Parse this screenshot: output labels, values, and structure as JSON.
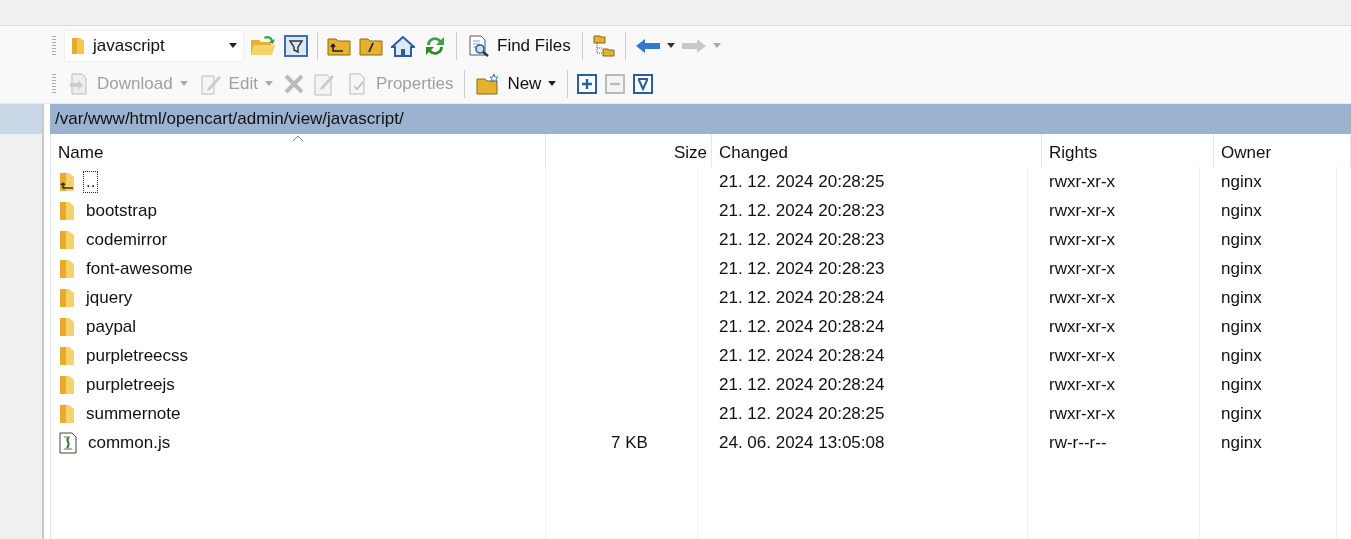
{
  "location": {
    "value": "javascript"
  },
  "find_files": {
    "label": "Find Files",
    "disabled": false
  },
  "actions": [
    {
      "kind": "download",
      "label": "Download",
      "disabled": true,
      "dropdown": true
    },
    {
      "kind": "edit",
      "label": "Edit",
      "disabled": true,
      "dropdown": true
    },
    {
      "kind": "properties",
      "label": "Properties",
      "disabled": true,
      "dropdown": false
    },
    {
      "kind": "new",
      "label": "New",
      "disabled": false,
      "dropdown": true
    }
  ],
  "path": "/var/www/html/opencart/admin/view/javascript/",
  "columns": [
    {
      "label": "Name",
      "sorted": true
    },
    {
      "label": "Size",
      "sorted": false
    },
    {
      "label": "Changed",
      "sorted": false
    },
    {
      "label": "Rights",
      "sorted": false
    },
    {
      "label": "Owner",
      "sorted": false
    }
  ],
  "rows": [
    {
      "kind": "parent",
      "name": "..",
      "changed": "21. 12. 2024 20:28:25",
      "rights": "rwxr-xr-x",
      "owner": "nginx",
      "focused": true
    },
    {
      "kind": "folder",
      "name": "bootstrap",
      "changed": "21. 12. 2024 20:28:23",
      "rights": "rwxr-xr-x",
      "owner": "nginx",
      "focused": false
    },
    {
      "kind": "folder",
      "name": "codemirror",
      "changed": "21. 12. 2024 20:28:23",
      "rights": "rwxr-xr-x",
      "owner": "nginx",
      "focused": false
    },
    {
      "kind": "folder",
      "name": "font-awesome",
      "changed": "21. 12. 2024 20:28:23",
      "rights": "rwxr-xr-x",
      "owner": "nginx",
      "focused": false
    },
    {
      "kind": "folder",
      "name": "jquery",
      "changed": "21. 12. 2024 20:28:24",
      "rights": "rwxr-xr-x",
      "owner": "nginx",
      "focused": false
    },
    {
      "kind": "folder",
      "name": "paypal",
      "changed": "21. 12. 2024 20:28:24",
      "rights": "rwxr-xr-x",
      "owner": "nginx",
      "focused": false
    },
    {
      "kind": "folder",
      "name": "purpletreecss",
      "changed": "21. 12. 2024 20:28:24",
      "rights": "rwxr-xr-x",
      "owner": "nginx",
      "focused": false
    },
    {
      "kind": "folder",
      "name": "purpletreejs",
      "changed": "21. 12. 2024 20:28:24",
      "rights": "rwxr-xr-x",
      "owner": "nginx",
      "focused": false
    },
    {
      "kind": "folder",
      "name": "summernote",
      "changed": "21. 12. 2024 20:28:25",
      "rights": "rwxr-xr-x",
      "owner": "nginx",
      "focused": false
    },
    {
      "kind": "file",
      "name": "common.js",
      "size": "7 KB",
      "changed": "24. 06. 2024 13:05:08",
      "rights": "rw-r--r--",
      "owner": "nginx",
      "focused": false
    }
  ]
}
